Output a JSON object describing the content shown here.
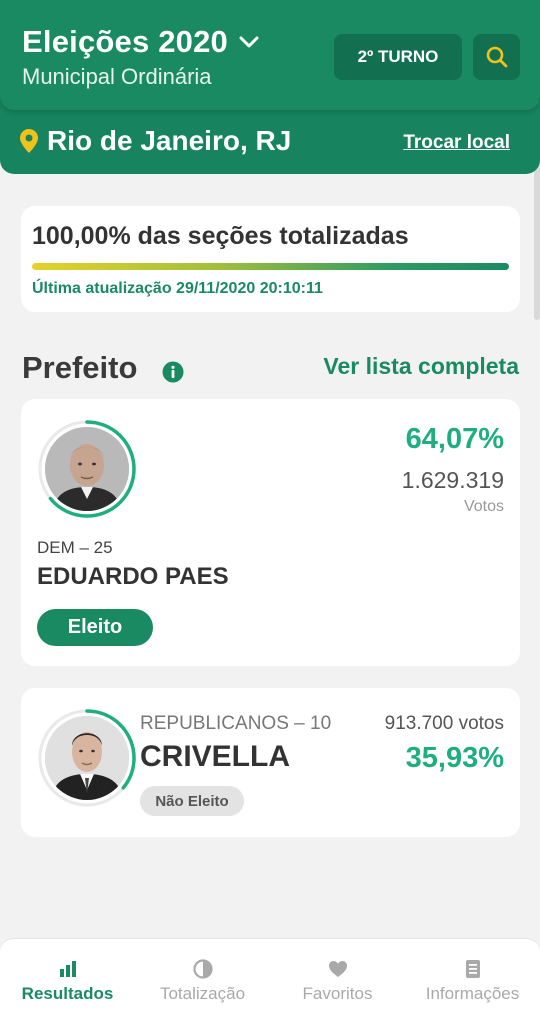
{
  "header": {
    "title": "Eleições 2020",
    "subtitle": "Municipal Ordinária",
    "turno_label": "2º TURNO",
    "search_icon": "search-icon",
    "dropdown_icon": "chevron-down-icon"
  },
  "location": {
    "name": "Rio de Janeiro, RJ",
    "change_label": "Trocar local",
    "icon": "location-pin-icon"
  },
  "progress": {
    "title": "100,00% das seções totalizadas",
    "fraction": 1.0,
    "updated": "Última atualização 29/11/2020 20:10:11"
  },
  "section": {
    "title": "Prefeito",
    "see_all_label": "Ver lista completa"
  },
  "candidates": [
    {
      "party": "DEM – 25",
      "name": "EDUARDO PAES",
      "percent": "64,07%",
      "percent_value": 64.07,
      "votes": "1.629.319",
      "votes_label": "Votos",
      "status": "Eleito"
    },
    {
      "party": "REPUBLICANOS – 10",
      "name": "CRIVELLA",
      "percent": "35,93%",
      "percent_value": 35.93,
      "votes": "913.700 votos",
      "status": "Não Eleito"
    }
  ],
  "nav": {
    "items": [
      {
        "label": "Resultados",
        "icon": "bar-chart-icon",
        "active": true
      },
      {
        "label": "Totalização",
        "icon": "pie-chart-icon",
        "active": false
      },
      {
        "label": "Favoritos",
        "icon": "heart-icon",
        "active": false
      },
      {
        "label": "Informações",
        "icon": "document-icon",
        "active": false
      }
    ]
  },
  "colors": {
    "primary": "#1a8a63",
    "accent_percent": "#1fae7f",
    "location_pin": "#f2c21b",
    "search_icon": "#f2c21b"
  }
}
